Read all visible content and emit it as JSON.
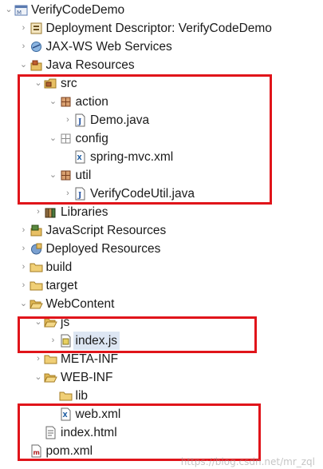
{
  "tree": [
    {
      "label": "VerifyCodeDemo",
      "depth": 0,
      "toggle": "open",
      "icon": "project-icon",
      "name": "tree-item-verifycodedemo"
    },
    {
      "label": "Deployment Descriptor: VerifyCodeDemo",
      "depth": 1,
      "toggle": "closed",
      "icon": "deployment-descriptor-icon",
      "name": "tree-item-deployment-descriptor"
    },
    {
      "label": "JAX-WS Web Services",
      "depth": 1,
      "toggle": "closed",
      "icon": "web-services-icon",
      "name": "tree-item-jaxws"
    },
    {
      "label": "Java Resources",
      "depth": 1,
      "toggle": "open",
      "icon": "java-resources-icon",
      "name": "tree-item-java-resources"
    },
    {
      "label": "src",
      "depth": 2,
      "toggle": "open",
      "icon": "source-folder-icon",
      "name": "tree-item-src"
    },
    {
      "label": "action",
      "depth": 3,
      "toggle": "open",
      "icon": "package-icon",
      "name": "tree-item-action"
    },
    {
      "label": "Demo.java",
      "depth": 4,
      "toggle": "closed",
      "icon": "java-file-icon",
      "name": "tree-item-demo-java"
    },
    {
      "label": "config",
      "depth": 3,
      "toggle": "open",
      "icon": "package-empty-icon",
      "name": "tree-item-config"
    },
    {
      "label": "spring-mvc.xml",
      "depth": 4,
      "toggle": "none",
      "icon": "xml-file-icon",
      "name": "tree-item-spring-mvc-xml"
    },
    {
      "label": "util",
      "depth": 3,
      "toggle": "open",
      "icon": "package-icon",
      "name": "tree-item-util"
    },
    {
      "label": "VerifyCodeUtil.java",
      "depth": 4,
      "toggle": "closed",
      "icon": "java-file-icon",
      "name": "tree-item-verifycodeutil-java"
    },
    {
      "label": "Libraries",
      "depth": 2,
      "toggle": "closed",
      "icon": "libraries-icon",
      "name": "tree-item-libraries"
    },
    {
      "label": "JavaScript Resources",
      "depth": 1,
      "toggle": "closed",
      "icon": "javascript-resources-icon",
      "name": "tree-item-javascript-resources"
    },
    {
      "label": "Deployed Resources",
      "depth": 1,
      "toggle": "closed",
      "icon": "deployed-resources-icon",
      "name": "tree-item-deployed-resources"
    },
    {
      "label": "build",
      "depth": 1,
      "toggle": "closed",
      "icon": "folder-icon",
      "name": "tree-item-build"
    },
    {
      "label": "target",
      "depth": 1,
      "toggle": "closed",
      "icon": "folder-icon",
      "name": "tree-item-target"
    },
    {
      "label": "WebContent",
      "depth": 1,
      "toggle": "open",
      "icon": "folder-open-icon",
      "name": "tree-item-webcontent"
    },
    {
      "label": "js",
      "depth": 2,
      "toggle": "open",
      "icon": "folder-open-icon",
      "name": "tree-item-js"
    },
    {
      "label": "index.js",
      "depth": 3,
      "toggle": "closed",
      "icon": "js-file-icon",
      "name": "tree-item-index-js",
      "selected": true
    },
    {
      "label": "META-INF",
      "depth": 2,
      "toggle": "closed",
      "icon": "folder-icon",
      "name": "tree-item-meta-inf"
    },
    {
      "label": "WEB-INF",
      "depth": 2,
      "toggle": "open",
      "icon": "folder-open-icon",
      "name": "tree-item-web-inf"
    },
    {
      "label": "lib",
      "depth": 3,
      "toggle": "none",
      "icon": "folder-icon",
      "name": "tree-item-lib"
    },
    {
      "label": "web.xml",
      "depth": 3,
      "toggle": "none",
      "icon": "xml-file-icon",
      "name": "tree-item-web-xml"
    },
    {
      "label": "index.html",
      "depth": 2,
      "toggle": "none",
      "icon": "html-file-icon",
      "name": "tree-item-index-html"
    },
    {
      "label": "pom.xml",
      "depth": 1,
      "toggle": "none",
      "icon": "maven-pom-icon",
      "name": "tree-item-pom-xml"
    }
  ],
  "watermark": "https://blog.csdn.net/mr_zql",
  "colors": {
    "highlight": "#e0141a",
    "folder": "#e8c065",
    "package": "#a0623a",
    "selection": "#dde6f3"
  }
}
